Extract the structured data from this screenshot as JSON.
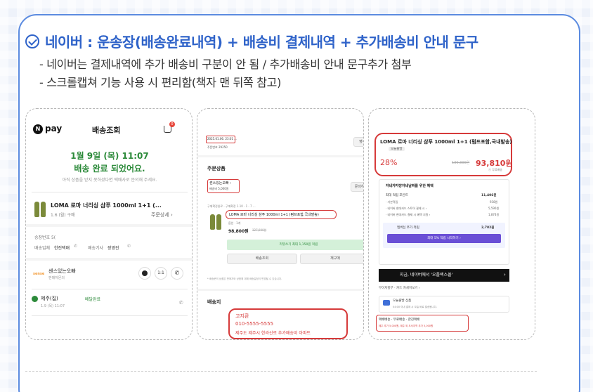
{
  "headline": "네이버 : 운송장(배송완료내역) + 배송비 결제내역 + 추가배송비 안내 문구",
  "bullets": [
    "- 네이버는 결제내역에 추가 배송비 구분이 안 됨 / 추가배송비 안내 문구추가 첨부",
    "- 스크롤캡쳐 기능 사용 시 편리함(책자 맨 뒤쪽 참고)"
  ],
  "colors": {
    "accent": "#2f63c9",
    "highlight_red": "#d63a3a",
    "status_green": "#2c8a3a",
    "naver_green": "#03c75a"
  },
  "shot1": {
    "logo_text": "pay",
    "title": "배송조회",
    "cart_badge": "0",
    "date_line": "1월 9일 (목) 11:07",
    "status_line": "배송 완료 되었어요.",
    "notice": "아직 상품을 받지 못하셨다면 택배사로 문의해 주세요.",
    "product_name": "LOMA 로마 너리싱 샴푸 1000ml 1+1 (...",
    "product_meta": "1.6 (월) 구매",
    "order_detail": "주문상세 ›",
    "tracking_label": "송장번호 5(",
    "courier_label": "배송업체",
    "courier_value": "한진택배",
    "driver_label": "배송기사",
    "driver_value": "장영진",
    "seller_logo": "sense",
    "seller_name": "센스있는오빠",
    "seller_sub": "판매자문의",
    "chat_btn": "1:1",
    "step_name": "제주(집)",
    "step_time": "1.9 (목) 11:07",
    "step_status": "배달완료"
  },
  "shot2": {
    "date_box": "2025.01.06. 23:01 ...",
    "order_no": "주문번호 29250",
    "receipt_btn": "영수증",
    "section_title": "주문상품",
    "seller_name": "센스있는오빠 ›",
    "ship_fee": "배송비 5,000원",
    "inquiry_btn": "문의하기",
    "confirm_line": "구매확정완료 · 구매확정 1.10 · 1 · 7 ...",
    "product_box": "LOMA 로마 너리싱 샴푸 1000ml 1+1 (펌프포함,국내발송)",
    "option": "옵션 · 1개",
    "price": "98,800원",
    "price_strike": "127,000원",
    "review_bar": "리뷰쓰기 최대 1,150원 적립",
    "btn_delivery": "배송조회",
    "btn_rebuy": "재구매",
    "fine_print": "* 배송문의 상품은 판매자와 상품에 대해 배송일정이 변경될 수 있습니다.",
    "addr_section": "배송지",
    "addr_name": "고지환",
    "addr_phone": "010-5555-5555",
    "addr_line": "제주도 제주시 한라산로 추가배송비 아파트"
  },
  "shot3": {
    "product_title": "LOMA 로마 너리싱 샴푸 1000ml 1+1 (펌프포함,국내발송)",
    "tag": "오늘출발",
    "discount": "28%",
    "strike_price": "130,300원",
    "price": "93,810원",
    "point_note": "ⓝ 무료배송",
    "benefit_title": "쟈네쟈쟈장쟈네날짜를 위한 혜택",
    "max_point_label": "최대 적립 포인트",
    "max_point_value": "11,406원",
    "rows": [
      {
        "label": "· 기본적립",
        "value": "938원"
      },
      {
        "label": "· 네이버 현대카드 스토어 결제 시 ›",
        "value": "5,590원"
      },
      {
        "label": "· 네이버 현대카드 결제 시 혜택 지원 ›",
        "value": "1,874원"
      }
    ],
    "plus_label": "멤버십 추가 적립",
    "plus_value": "2,782원",
    "plus_bar": "최대 5% 적립 시작하기 ›",
    "banner": "지금, 네이버에서 '오플렉스몰'",
    "installment": "무이자할부 · 카드 자세히보기 ›",
    "today_label": "오늘출발 상품",
    "today_sub": "04:00 이내 결제 시 오늘 바로 발송됩니다.",
    "ship_type": "택배배송 · 무료배송 · 한진택배",
    "ship_note": "제주 추가 5,000원, 제주 외 도서지역 추가 5,000원"
  }
}
